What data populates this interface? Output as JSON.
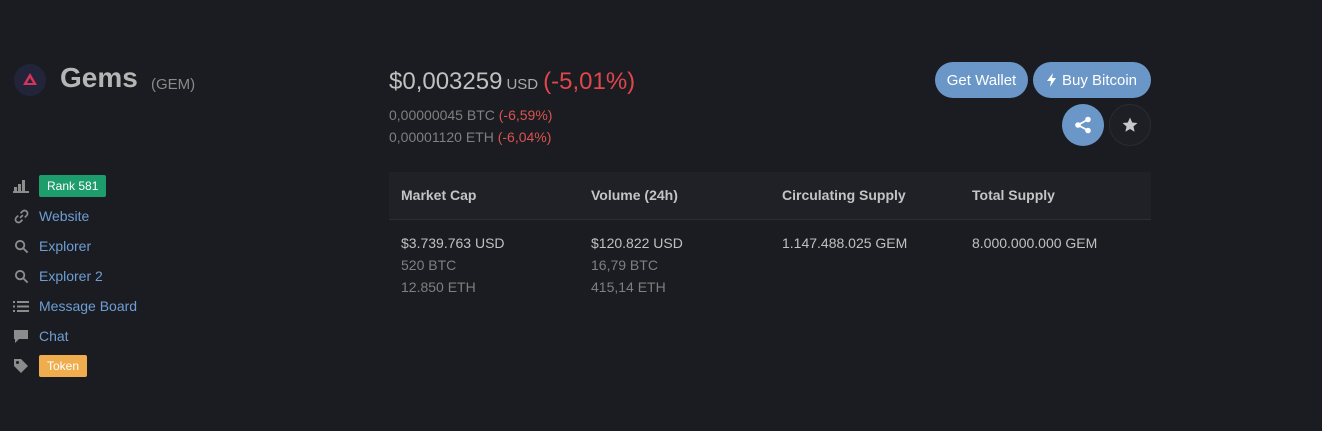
{
  "coin": {
    "name": "Gems",
    "symbol": "(GEM)"
  },
  "sidebar": {
    "rank_badge": "Rank 581",
    "links": [
      "Website",
      "Explorer",
      "Explorer 2",
      "Message Board",
      "Chat"
    ],
    "token_badge": "Token"
  },
  "price": {
    "usd": "$0,003259",
    "usd_unit": "USD",
    "usd_change": "(-5,01%)",
    "btc": "0,00000045 BTC",
    "btc_change": "(-6,59%)",
    "eth": "0,00001120 ETH",
    "eth_change": "(-6,04%)"
  },
  "buttons": {
    "get_wallet": "Get Wallet",
    "buy_bitcoin": "Buy Bitcoin"
  },
  "stats": {
    "headers": [
      "Market Cap",
      "Volume (24h)",
      "Circulating Supply",
      "Total Supply"
    ],
    "market_cap": {
      "usd": "$3.739.763 USD",
      "btc": "520 BTC",
      "eth": "12.850 ETH"
    },
    "volume": {
      "usd": "$120.822 USD",
      "btc": "16,79 BTC",
      "eth": "415,14 ETH"
    },
    "circulating_supply": "1.147.488.025 GEM",
    "total_supply": "8.000.000.000 GEM"
  },
  "colors": {
    "background": "#1b1c21",
    "link": "#6d9ed4",
    "negative": "#d9534f",
    "button": "#6a97c8",
    "rank_badge": "#1c9d6b",
    "token_badge": "#f0ad4e"
  }
}
